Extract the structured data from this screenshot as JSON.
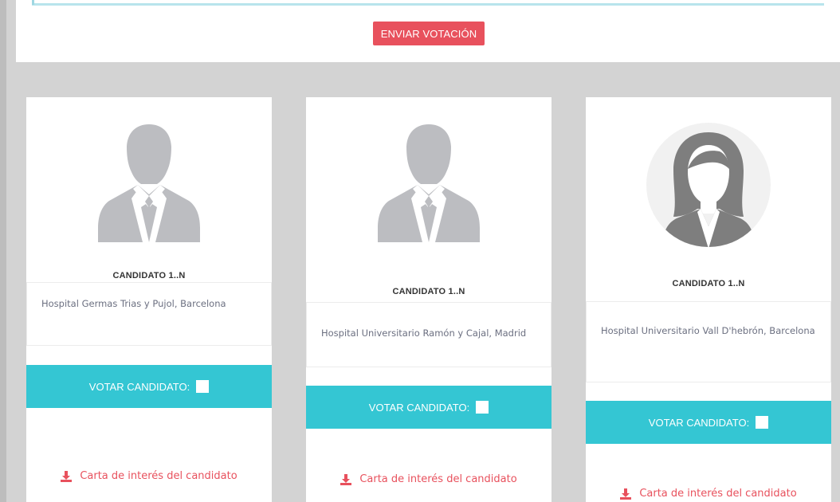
{
  "form": {
    "submit_label": "ENVIAR VOTACIÓN"
  },
  "candidates": [
    {
      "name": "CANDIDATO 1..N",
      "hospital": "Hospital Germas Trias y Pujol, Barcelona",
      "vote_label": "VOTAR CANDIDATO:",
      "letter_label": "Carta de interés del candidato",
      "avatar_icon": "male-avatar-icon"
    },
    {
      "name": "CANDIDATO 1..N",
      "hospital": "Hospital Universitario Ramón y Cajal, Madrid",
      "vote_label": "VOTAR CANDIDATO:",
      "letter_label": "Carta de interés del candidato",
      "avatar_icon": "male-avatar-icon"
    },
    {
      "name": "CANDIDATO 1..N",
      "hospital": "Hospital Universitario Vall D'hebrón, Barcelona",
      "vote_label": "VOTAR CANDIDATO:",
      "letter_label": "Carta de interés del candidato",
      "avatar_icon": "female-avatar-icon"
    }
  ],
  "colors": {
    "accent_red": "#e8515d",
    "vote_teal": "#34c6d3",
    "page_gray": "#d3d3d3",
    "avatar_gray": "#bcbdc1"
  }
}
